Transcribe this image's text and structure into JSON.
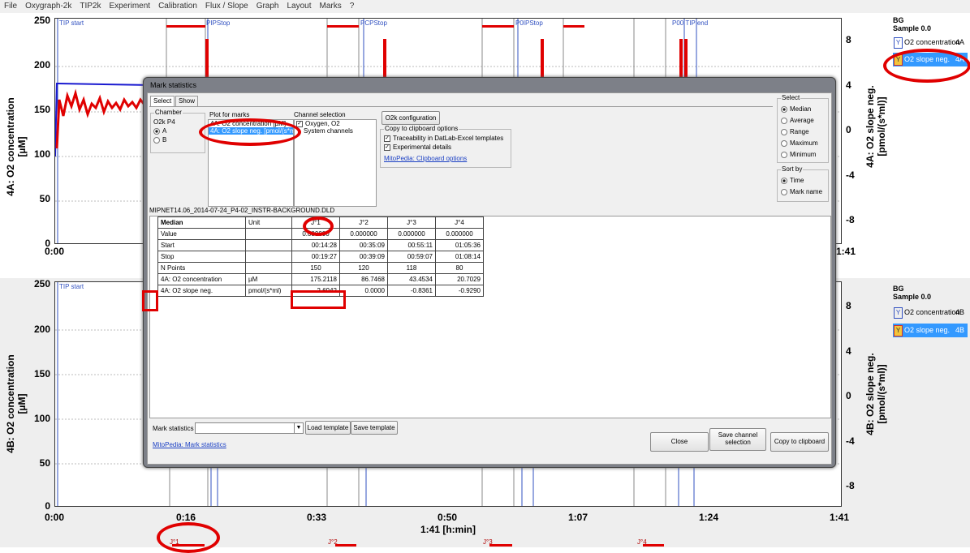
{
  "menu": [
    "File",
    "Oxygraph-2k",
    "TIP2k",
    "Experiment",
    "Calibration",
    "Flux / Slope",
    "Graph",
    "Layout",
    "Marks",
    "?"
  ],
  "top_graph": {
    "y_ticks": [
      "250",
      "200",
      "150",
      "100",
      "50",
      "0"
    ],
    "right_ticks": [
      "8",
      "4",
      "0",
      "-4",
      "-8"
    ],
    "x_ticks": [
      "0:00",
      "1:41"
    ],
    "ylabel": "4A: O2 concentration\n[µM]",
    "ylabel_right": "4A: O2 slope neg.\n[pmol/(s*ml)]",
    "marks": [
      "TIP start",
      "PIPStop",
      "PCPStop",
      "P0IPStop",
      "P00 TIP end"
    ],
    "legend": {
      "hdr1": "BG",
      "hdr2": "Sample 0.0",
      "item1": "O2 concentration",
      "unit1": "4A",
      "item2": "O2 slope neg.",
      "unit2": "4A"
    }
  },
  "bottom_graph": {
    "y_ticks": [
      "250",
      "200",
      "150",
      "100",
      "50",
      "0"
    ],
    "right_ticks": [
      "8",
      "4",
      "0",
      "-4",
      "-8"
    ],
    "x_ticks": [
      "0:00",
      "0:16",
      "0:33",
      "0:50",
      "1:07",
      "1:24",
      "1:41"
    ],
    "x_label": "1:41 [h:min]",
    "ylabel": "4B: O2 concentration\n[µM]",
    "ylabel_right": "4B: O2 slope neg.\n[pmol/(s*ml)]",
    "marks": [
      "TIP start"
    ],
    "bottom_marks": [
      "J°1",
      "J°2",
      "J°3",
      "J°4"
    ],
    "legend": {
      "hdr1": "BG",
      "hdr2": "Sample 0.0",
      "item1": "O2 concentration",
      "unit1": "4B",
      "item2": "O2 slope neg.",
      "unit2": "4B"
    }
  },
  "dialog": {
    "title": "Mark statistics",
    "tabs": [
      "Select",
      "Show"
    ],
    "chamber": {
      "title": "Chamber",
      "device": "O2k P4",
      "options": [
        "A",
        "B"
      ],
      "selected": "A"
    },
    "plot_for_marks": {
      "title": "Plot for marks",
      "items": [
        "4A: O2 concentration [µM]",
        "4A: O2 slope neg. [pmol/(s*ml)]"
      ],
      "selected": "4A: O2 slope neg. [pmol/(s*ml)]"
    },
    "channel_selection": {
      "title": "Channel selection",
      "items": [
        "Oxygen, O2",
        "System channels"
      ]
    },
    "o2k_config_button": "O2k configuration",
    "clipboard_options": {
      "title": "Copy to clipboard options",
      "items": [
        "Traceability in DatLab-Excel templates",
        "Experimental details"
      ],
      "link": "MitoPedia: Clipboard options"
    },
    "select": {
      "title": "Select",
      "options": [
        "Median",
        "Average",
        "Range",
        "Maximum",
        "Minimum"
      ],
      "selected": "Median"
    },
    "sort_by": {
      "title": "Sort by",
      "options": [
        "Time",
        "Mark name"
      ],
      "selected": "Time"
    },
    "file_path": "MIPNET14.06_2014-07-24_P4-02_INSTR-BACKGROUND.DLD",
    "table": {
      "header": [
        "Median",
        "Unit",
        "J°1",
        "J°2",
        "J°3",
        "J°4"
      ],
      "rows": [
        {
          "label": "Value",
          "unit": "",
          "values": [
            "0.000000",
            "0.000000",
            "0.000000",
            "0.000000"
          ],
          "align": "center"
        },
        {
          "label": "Start",
          "unit": "",
          "values": [
            "00:14:28",
            "00:35:09",
            "00:55:11",
            "01:05:36"
          ],
          "align": "num"
        },
        {
          "label": "Stop",
          "unit": "",
          "values": [
            "00:19:27",
            "00:39:09",
            "00:59:07",
            "01:08:14"
          ],
          "align": "num"
        },
        {
          "label": "N Points",
          "unit": "",
          "values": [
            "150",
            "120",
            "118",
            "80"
          ],
          "align": "center"
        },
        {
          "label": "4A: O2 concentration",
          "unit": "µM",
          "values": [
            "175.2118",
            "86.7468",
            "43.4534",
            "20.7029"
          ],
          "align": "num"
        },
        {
          "label": "4A: O2 slope neg.",
          "unit": "pmol/(s*ml)",
          "values": [
            "2.6942",
            "0.0000",
            "-0.8361",
            "-0.9290"
          ],
          "align": "num"
        }
      ]
    },
    "bottom": {
      "mark_stats_label": "Mark statistics",
      "combo_value": "",
      "load_template": "Load template",
      "save_template": "Save template",
      "link": "MitoPedia: Mark statistics",
      "close": "Close",
      "save_channel_selection": "Save channel selection",
      "copy_to_clipboard": "Copy to clipboard"
    }
  },
  "colors": {
    "o2_concentration": "#1a1ad0",
    "o2_slope": "#e00000",
    "selection": "#3399ff"
  }
}
